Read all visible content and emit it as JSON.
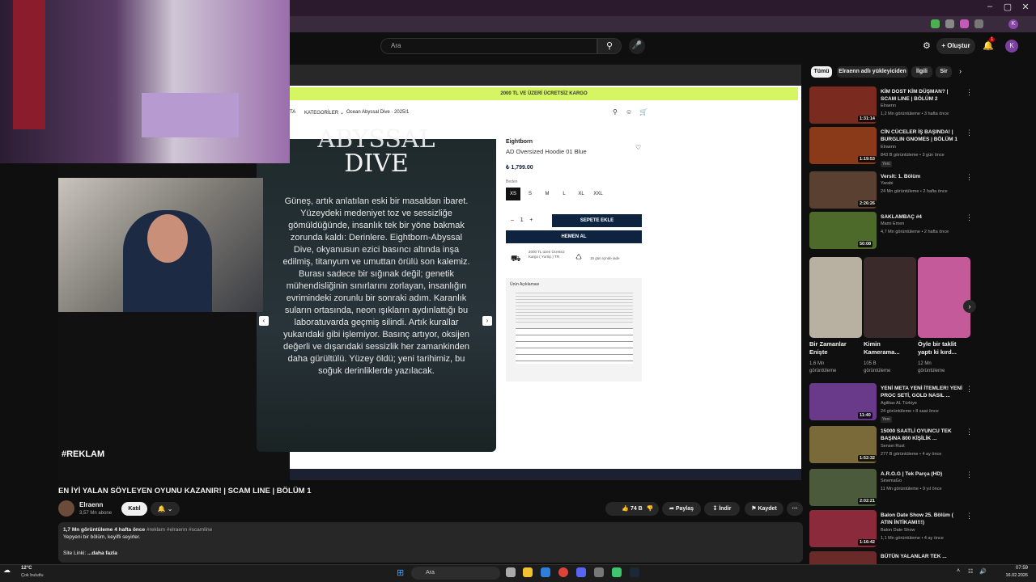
{
  "browser": {
    "window_controls": [
      "–",
      "▢",
      "✕"
    ],
    "profile_initial": "K"
  },
  "youtube": {
    "search_placeholder": "Ara",
    "create_label": "Oluştur",
    "notif_count": "1",
    "account_initial": "K"
  },
  "stream": {
    "promo_text": "2000 TL VE ÜZERİ ÜCRETSİZ KARGO",
    "site_nav": [
      "TA",
      "KATEGORİLER ⌄",
      "Ocean Abyssal Dive · 2025/1"
    ],
    "art_title": "DIVE",
    "art_title_top": "ABYSSAL",
    "art_body": "Güneş, artık anlatılan eski bir masaldan ibaret. Yüzeydeki medeniyet toz ve sessizliğe gömüldüğünde, insanlık tek bir yöne bakmak zorunda kaldı: Derinlere. Eightborn-Abyssal Dive, okyanusun ezici basıncı altında inşa edilmiş, titanyum ve umuttan örülü son kalemiz. Burası sadece bir sığınak değil; genetik mühendisliğinin sınırlarını zorlayan, insanlığın evrimindeki zorunlu bir sonraki adım. Karanlık suların ortasında, neon ışıkların aydınlattığı bu laboratuvarda geçmiş silindi. Artık kurallar yukarıdaki gibi işlemiyor. Basınç artıyor, oksijen değerli ve dışarıdaki sessizlik her zamankinden daha gürültülü. Yüzey öldü; yeni tarihimiz, bu soğuk derinliklerde yazılacak.",
    "brand": "Eightborn",
    "product_name": "AD Oversized Hoodie 01 Blue",
    "price": "₺ 1,799.00",
    "size_label": "Beden",
    "sizes": [
      "XS",
      "S",
      "M",
      "L",
      "XL",
      "XXL"
    ],
    "qty": "1",
    "add_to_cart": "SEPETE EKLE",
    "buy_now": "HEMEN AL",
    "shipping_note": "2000 TL üzeri Ücretsiz Kargo ( Yurtiçi ) TR",
    "return_note": "15 gün içinde iade",
    "desc_header": "Ürün Açıklaması",
    "ad_label": "#REKLAM"
  },
  "video": {
    "title": "EN İYİ YALAN SÖYLEYEN OYUNU KAZANIR! | SCAM LINE | BÖLÜM 1",
    "channel": "Elraenn",
    "subs": "3,57 Mn abone",
    "join": "Katıl",
    "likes": "74 B",
    "share": "Paylaş",
    "download": "İndir",
    "save": "Kaydet",
    "views_line": "1,7 Mn görüntüleme  4 hafta önce",
    "hashtags": "#reklam #elraenn #scamline",
    "desc_line": "Yepyeni bir bölüm, keyifli seyirler.",
    "site_link": "Site Linki:",
    "more": "...daha fazla"
  },
  "chips": [
    "Tümü",
    "Elraenn adlı yükleyiciden",
    "İlgili",
    "Sir"
  ],
  "recs": [
    {
      "title": "KİM DOST KİM DÜŞMAN? | SCAM LINE | BÖLÜM 2",
      "channel": "Elraenn",
      "meta": "1,2 Mn görüntüleme • 3 hafta önce",
      "dur": "1:31:14",
      "color": "#7a2a1f"
    },
    {
      "title": "CİN CÜCELER İŞ BAŞINDA! | BURGLIN GNOMES | BÖLÜM 1",
      "channel": "Elraenn",
      "meta": "843 B görüntüleme • 3 gün önce",
      "dur": "1:19:53",
      "color": "#8a3a18",
      "badge": "Yeni"
    },
    {
      "title": "Verslt: 1. Bölüm",
      "channel": "Yarabi",
      "meta": "24 Mn görüntüleme • 2 hafta önce",
      "dur": "2:26:26",
      "color": "#5a4030"
    },
    {
      "title": "SAKLAMBAÇ #4",
      "channel": "Mami Emen",
      "meta": "4,7 Mn görüntüleme • 2 hafta önce",
      "dur": "50:08",
      "color": "#4d6a2a"
    },
    {
      "title": "YENİ META YENİ İTEMLER! YENİ PROC SETİ, GOLD NASIL ...",
      "channel": "Agilitas AL Türkiye",
      "meta": "24 görüntüleme • 8 saat önce",
      "dur": "11:40",
      "color": "#6a3a8a",
      "badge": "Yeni"
    },
    {
      "title": "15000 SAATLİ OYUNCU TEK BAŞINA 800 KİŞİLİK ...",
      "channel": "Sensei Rust",
      "meta": "277 B görüntüleme • 4 ay önce",
      "dur": "1:52:32",
      "color": "#7a6a3a"
    },
    {
      "title": "A.R.O.G | Tek Parça (HD)",
      "channel": "SinemaGo",
      "meta": "11 Mn görüntüleme • 9 yıl önce",
      "dur": "2:02:21",
      "color": "#4a5a3a"
    },
    {
      "title": "Balon Date Show 25. Bölüm ( ATIN İNTİKAMI!!!)",
      "channel": "Balon Date Show",
      "meta": "1,1 Mn görüntüleme • 4 ay önce",
      "dur": "1:16:42",
      "color": "#8a2a3a"
    },
    {
      "title": "BÜTÜN YALANLAR TEK ...",
      "channel": "",
      "meta": "",
      "dur": "",
      "color": "#6a2a2a"
    }
  ],
  "shorts": [
    {
      "title": "Bir Zamanlar Enişte",
      "views": "1,6 Mn görüntüleme",
      "color": "#b8b0a0"
    },
    {
      "title": "Kimin Kamerama...",
      "views": "105 B görüntüleme",
      "color": "#3a2a2a"
    },
    {
      "title": "Öyle bir taklit yaptı ki kırd...",
      "views": "12 Mn görüntüleme",
      "color": "#c45a9a"
    }
  ],
  "taskbar": {
    "weather_temp": "12°C",
    "weather_desc": "Çok bulutlu",
    "search": "Ara",
    "time": "07:59",
    "date": "16.02.2026"
  }
}
